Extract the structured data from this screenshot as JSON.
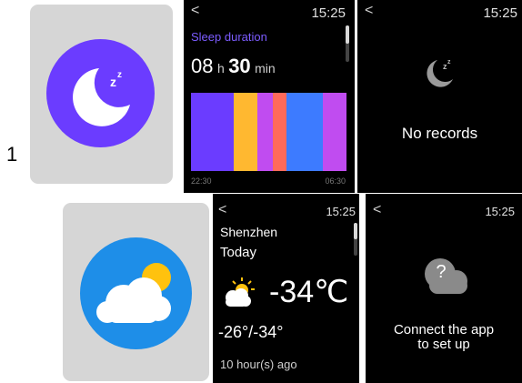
{
  "marker": "1",
  "sleep": {
    "app_icon": "moon-zzz-icon",
    "detail": {
      "time": "15:25",
      "title": "Sleep duration",
      "hours": "08",
      "h_unit": "h",
      "minutes": "30",
      "min_unit": "min",
      "start_time": "22:30",
      "end_time": "06:30",
      "colors": {
        "title": "#7c5cff",
        "deep": "#6b3cff",
        "light": "#ffb830",
        "rem": "#c04cf0",
        "awake": "#ff6a5a",
        "core": "#3d7bff"
      },
      "segments": [
        {
          "stage": "deep",
          "color": "#6b3cff"
        },
        {
          "stage": "light",
          "color": "#ffb830"
        },
        {
          "stage": "rem",
          "color": "#c04cf0"
        },
        {
          "stage": "awake",
          "color": "#ff6a5a"
        },
        {
          "stage": "core",
          "color": "#3d7bff"
        },
        {
          "stage": "rem",
          "color": "#c04cf0"
        }
      ]
    },
    "empty": {
      "time": "15:25",
      "icon": "moon-zzz-icon",
      "message": "No records"
    }
  },
  "weather": {
    "app_icon": "cloud-sun-icon",
    "detail": {
      "time": "15:25",
      "city": "Shenzhen",
      "day": "Today",
      "condition_icon": "partly-cloudy-icon",
      "temperature": "-34℃",
      "high": "-26°",
      "separator": "/",
      "low": "-34°",
      "updated": "10 hour(s) ago"
    },
    "empty": {
      "time": "15:25",
      "icon": "cloud-question-icon",
      "question_mark": "?",
      "message_line1": "Connect the app",
      "message_line2": "to set up"
    }
  },
  "colors": {
    "sleep_app": "#6b3cff",
    "weather_app": "#1e8ee8",
    "sun": "#ffc20e"
  }
}
